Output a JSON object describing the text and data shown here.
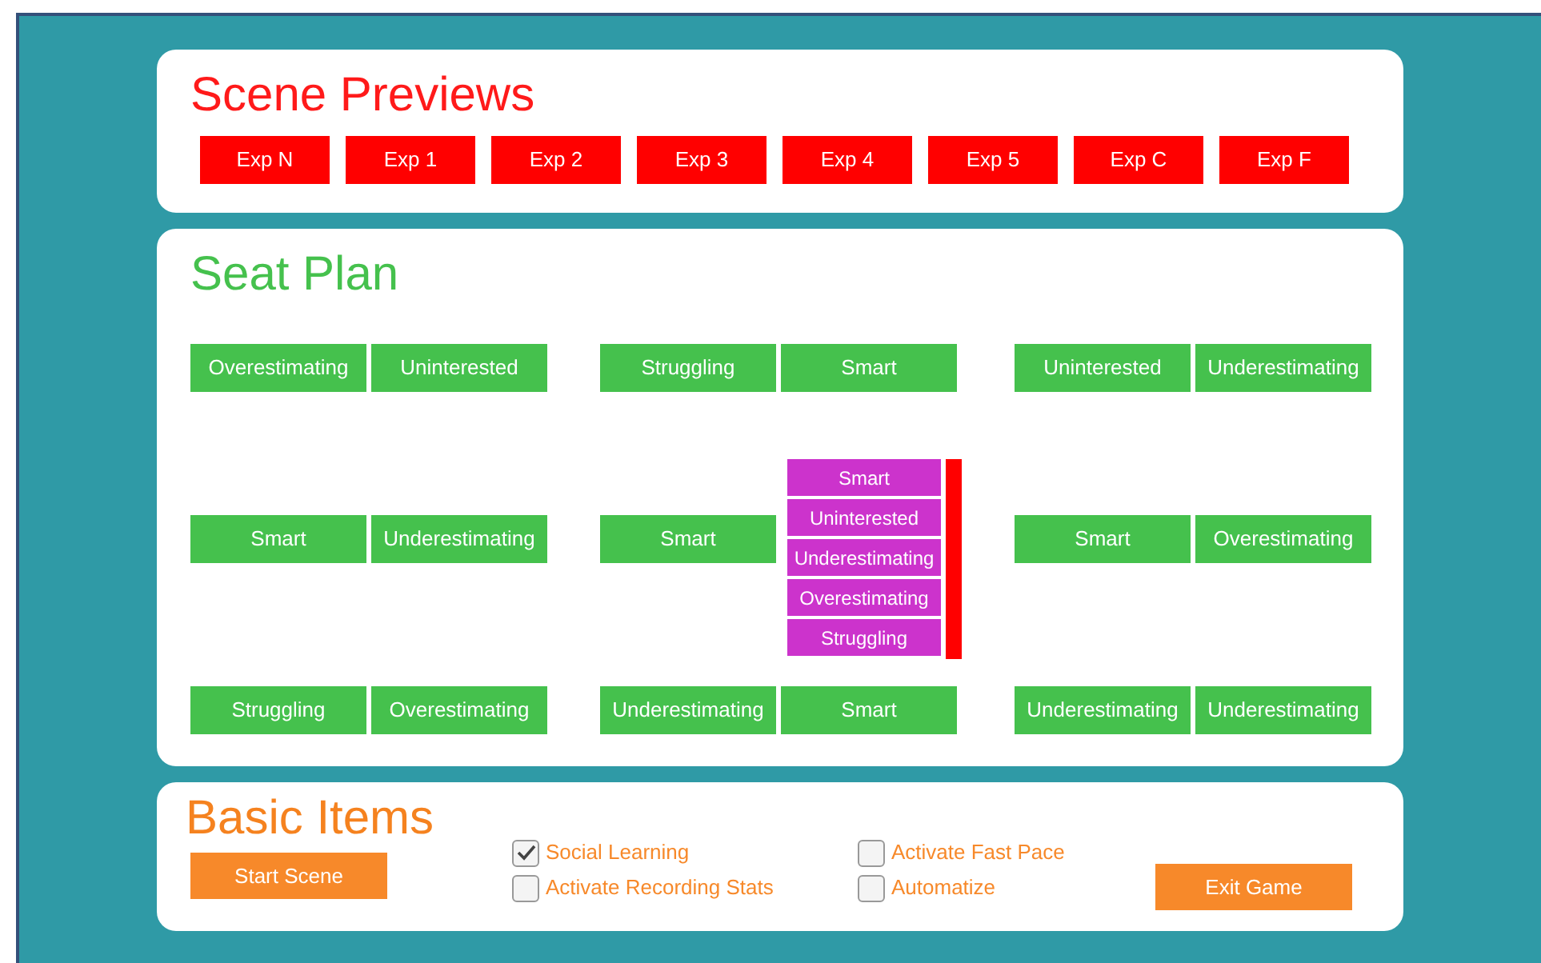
{
  "scene_previews": {
    "title": "Scene Previews",
    "buttons": [
      "Exp N",
      "Exp 1",
      "Exp 2",
      "Exp 3",
      "Exp 4",
      "Exp 5",
      "Exp C",
      "Exp F"
    ]
  },
  "seat_plan": {
    "title": "Seat Plan",
    "groups": [
      {
        "seats": [
          {
            "kind": "button",
            "label": "Overestimating"
          },
          {
            "kind": "button",
            "label": "Uninterested"
          },
          {
            "kind": "button",
            "label": "Smart"
          },
          {
            "kind": "button",
            "label": "Underestimating"
          },
          {
            "kind": "button",
            "label": "Struggling"
          },
          {
            "kind": "button",
            "label": "Overestimating"
          }
        ]
      },
      {
        "seats": [
          {
            "kind": "button",
            "label": "Struggling"
          },
          {
            "kind": "button",
            "label": "Smart"
          },
          {
            "kind": "button",
            "label": "Smart"
          },
          {
            "kind": "button",
            "label": "Underestimating"
          },
          {
            "kind": "button",
            "label": "Smart"
          }
        ],
        "dropdown": {
          "options": [
            "Smart",
            "Uninterested",
            "Underestimating",
            "Overestimating",
            "Struggling"
          ]
        }
      },
      {
        "seats": [
          {
            "kind": "button",
            "label": "Uninterested"
          },
          {
            "kind": "button",
            "label": "Underestimating"
          },
          {
            "kind": "button",
            "label": "Smart"
          },
          {
            "kind": "button",
            "label": "Overestimating"
          },
          {
            "kind": "button",
            "label": "Underestimating"
          },
          {
            "kind": "button",
            "label": "Underestimating"
          }
        ]
      }
    ]
  },
  "basic_items": {
    "title": "Basic Items",
    "start_button": "Start Scene",
    "checkboxes": [
      {
        "label": "Social Learning",
        "checked": true
      },
      {
        "label": "Activate Recording Stats",
        "checked": false
      },
      {
        "label": "Activate Fast Pace",
        "checked": false
      },
      {
        "label": "Automatize",
        "checked": false
      }
    ],
    "exit_button": "Exit Game"
  }
}
